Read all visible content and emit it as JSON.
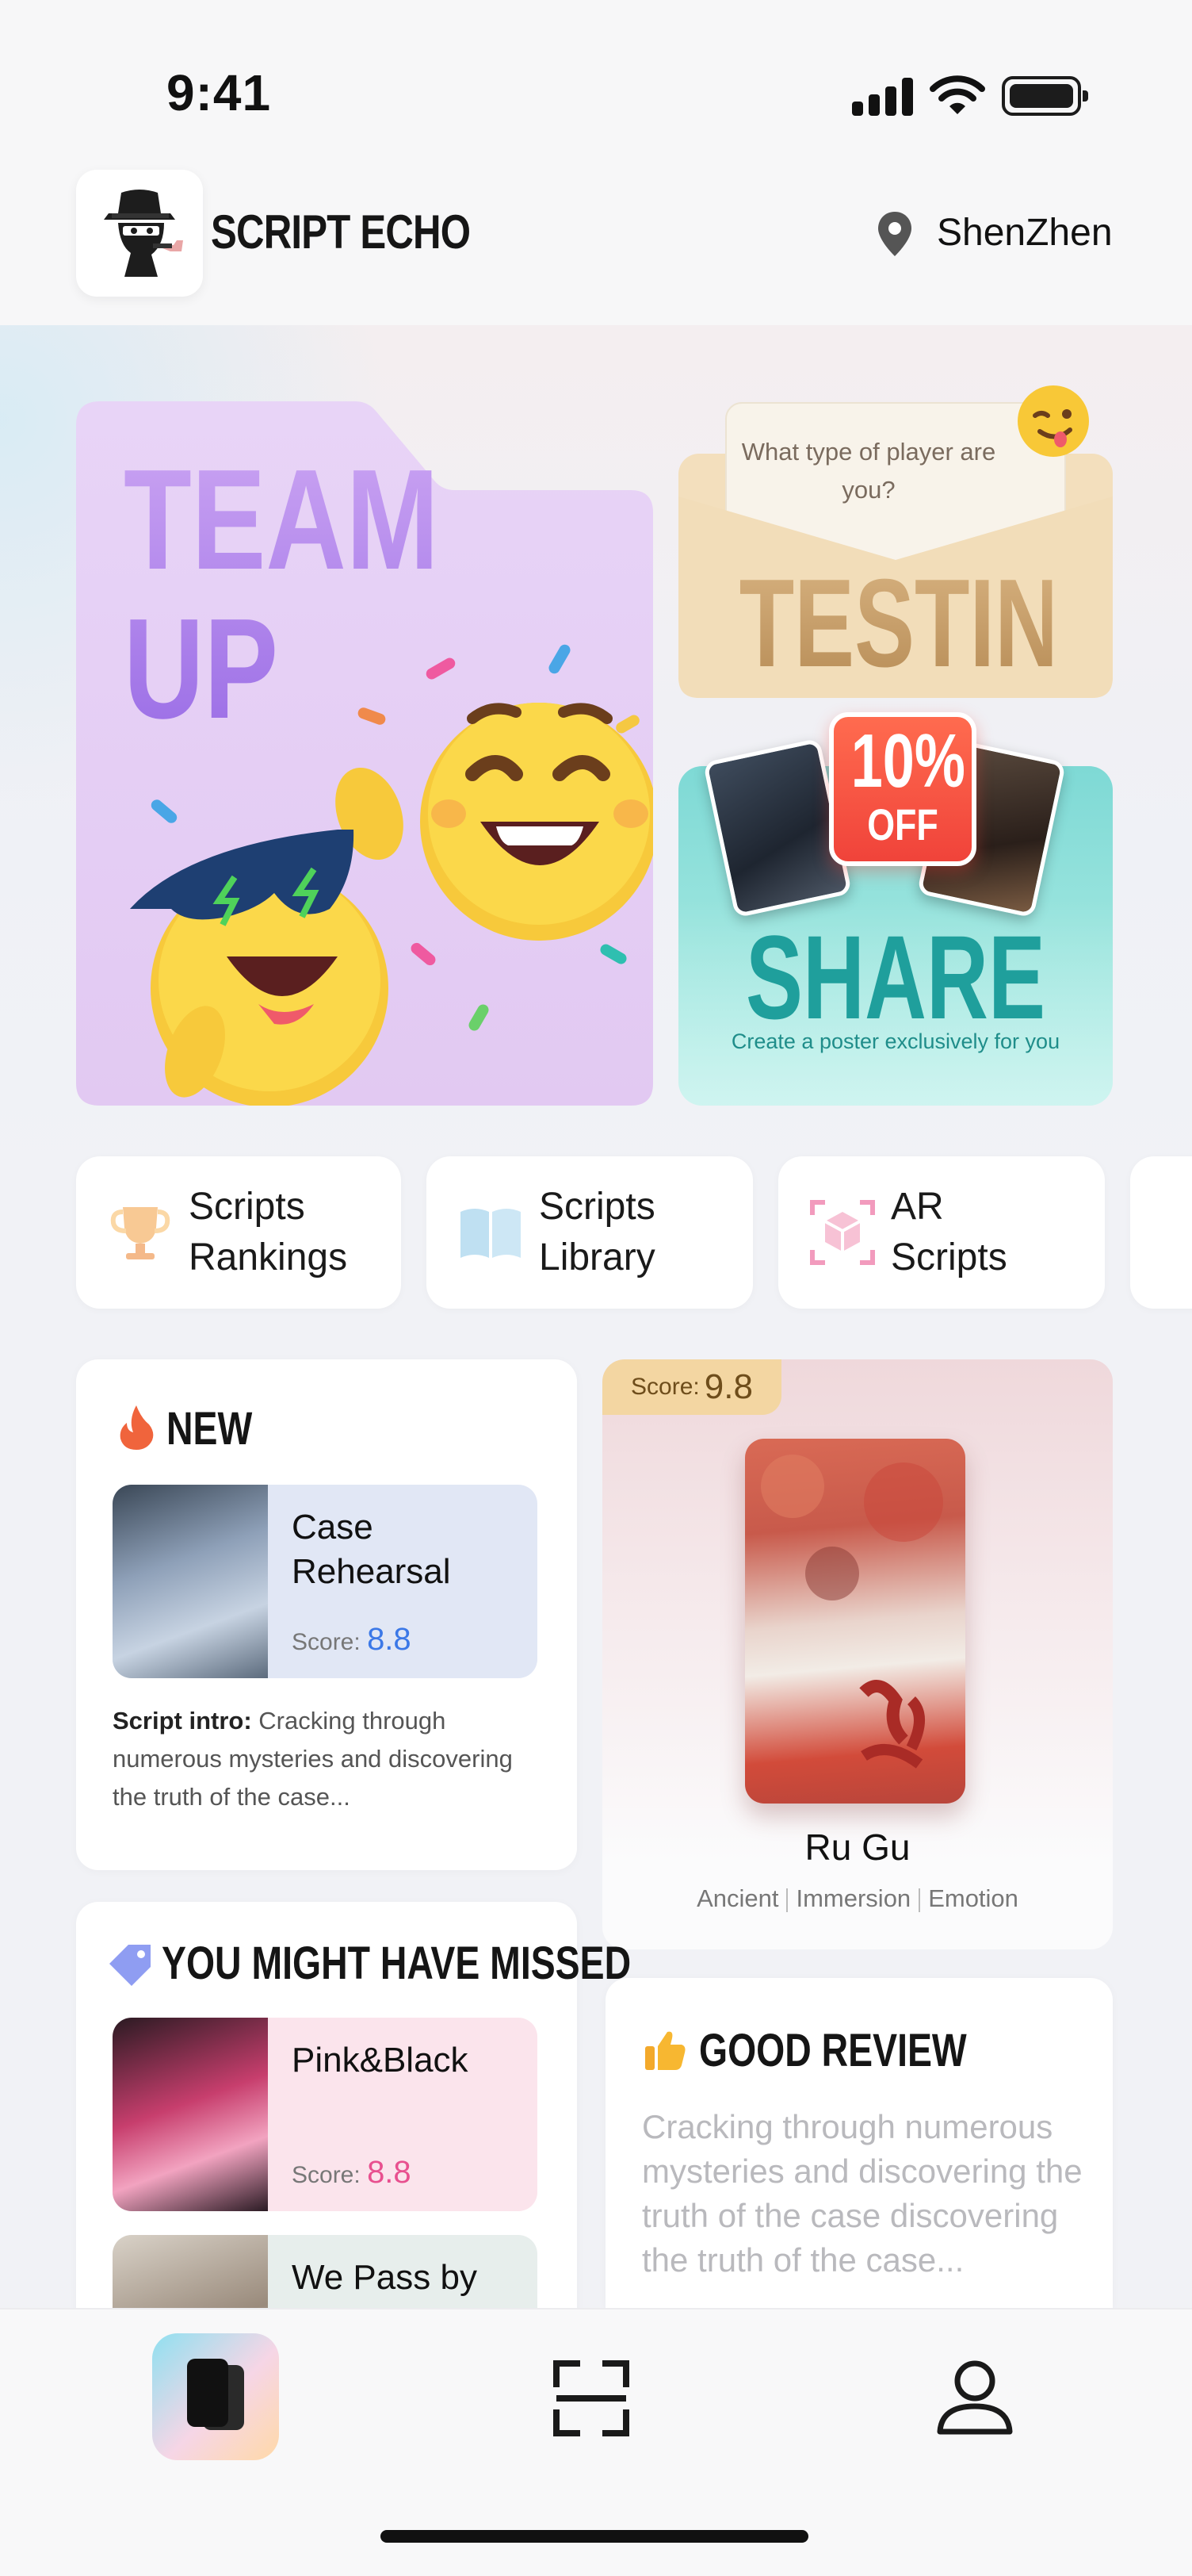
{
  "status_bar": {
    "time": "9:41"
  },
  "header": {
    "app_name": "SCRIPT ECHO",
    "location": "ShenZhen"
  },
  "banners": {
    "team_up": {
      "title": "TEAM\nUP"
    },
    "testing": {
      "question": "What type of player are you?",
      "title": "TESTING"
    },
    "share": {
      "badge_pct": "10%",
      "badge_off": "OFF",
      "title": "SHARE",
      "subtitle": "Create a poster exclusively for you"
    }
  },
  "quick_nav": [
    {
      "label": "Scripts Rankings",
      "icon": "trophy-icon"
    },
    {
      "label": "Scripts Library",
      "icon": "book-icon"
    },
    {
      "label": "AR Scripts",
      "icon": "ar-cube-icon"
    }
  ],
  "new_section": {
    "title": "NEW",
    "item": {
      "name": "Case Rehearsal",
      "score_label": "Score:",
      "score": "8.8"
    },
    "intro_label": "Script intro:",
    "intro_text": "Cracking through numerous mysteries and discovering the truth of the case..."
  },
  "featured": {
    "score_label": "Score:",
    "score": "9.8",
    "name": "Ru Gu",
    "tags": [
      "Ancient",
      "Immersion",
      "Emotion"
    ]
  },
  "missed_section": {
    "title": "YOU MIGHT HAVE MISSED",
    "items": [
      {
        "name": "Pink&Black",
        "score_label": "Score:",
        "score": "8.8"
      },
      {
        "name": "We Pass by"
      }
    ]
  },
  "review_section": {
    "title": "GOOD REVIEW",
    "text": "Cracking through numerous mysteries and discovering the truth of the case discovering the truth of the case..."
  },
  "tab_bar": {
    "tabs": [
      "home-tab",
      "scan-tab",
      "profile-tab"
    ]
  },
  "colors": {
    "accent_blue": "#3b78e7",
    "accent_pink": "#e8508f",
    "share_teal": "#1f9f9c",
    "testing_gold": "#c49a63"
  }
}
